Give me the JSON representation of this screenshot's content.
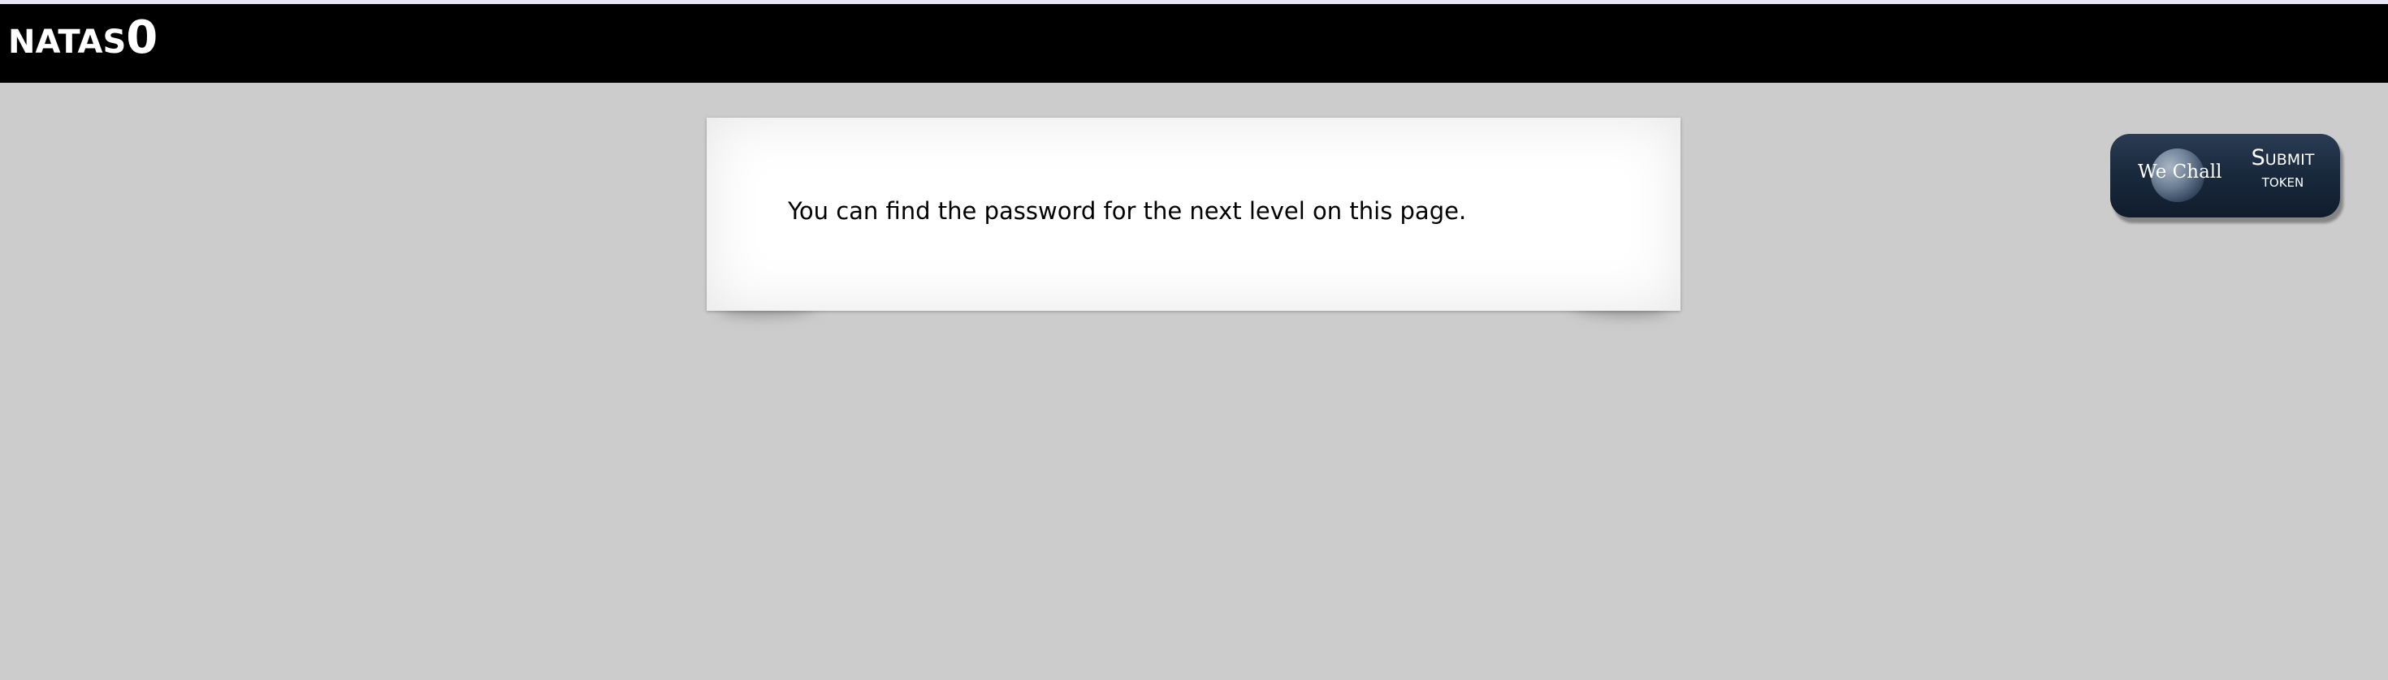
{
  "header": {
    "brand_word": "NATAS",
    "brand_number": "0"
  },
  "content": {
    "message": "You can find the password for the next level on this page."
  },
  "wechall": {
    "logo_text": "We Chall",
    "submit_line1": "Submit",
    "submit_line2": "token"
  },
  "colors": {
    "header_bg": "#000000",
    "page_bg": "#cccccc",
    "card_bg": "#ffffff",
    "button_bg": "#1a2a3e"
  }
}
